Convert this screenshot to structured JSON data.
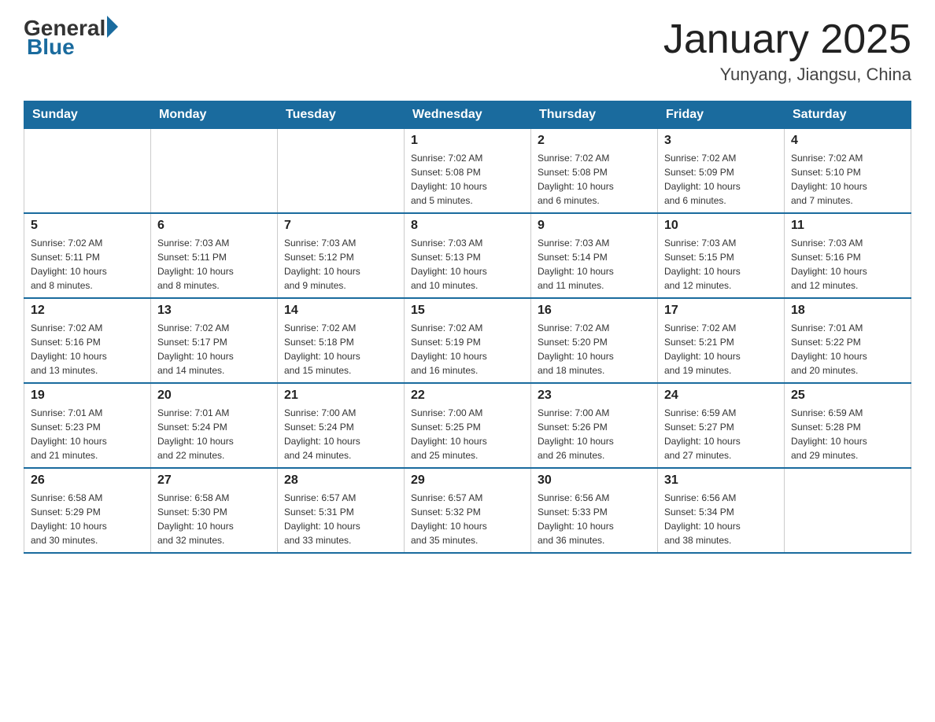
{
  "header": {
    "logo_general": "General",
    "logo_blue": "Blue",
    "month_title": "January 2025",
    "location": "Yunyang, Jiangsu, China"
  },
  "weekdays": [
    "Sunday",
    "Monday",
    "Tuesday",
    "Wednesday",
    "Thursday",
    "Friday",
    "Saturday"
  ],
  "weeks": [
    [
      {
        "day": "",
        "info": ""
      },
      {
        "day": "",
        "info": ""
      },
      {
        "day": "",
        "info": ""
      },
      {
        "day": "1",
        "info": "Sunrise: 7:02 AM\nSunset: 5:08 PM\nDaylight: 10 hours\nand 5 minutes."
      },
      {
        "day": "2",
        "info": "Sunrise: 7:02 AM\nSunset: 5:08 PM\nDaylight: 10 hours\nand 6 minutes."
      },
      {
        "day": "3",
        "info": "Sunrise: 7:02 AM\nSunset: 5:09 PM\nDaylight: 10 hours\nand 6 minutes."
      },
      {
        "day": "4",
        "info": "Sunrise: 7:02 AM\nSunset: 5:10 PM\nDaylight: 10 hours\nand 7 minutes."
      }
    ],
    [
      {
        "day": "5",
        "info": "Sunrise: 7:02 AM\nSunset: 5:11 PM\nDaylight: 10 hours\nand 8 minutes."
      },
      {
        "day": "6",
        "info": "Sunrise: 7:03 AM\nSunset: 5:11 PM\nDaylight: 10 hours\nand 8 minutes."
      },
      {
        "day": "7",
        "info": "Sunrise: 7:03 AM\nSunset: 5:12 PM\nDaylight: 10 hours\nand 9 minutes."
      },
      {
        "day": "8",
        "info": "Sunrise: 7:03 AM\nSunset: 5:13 PM\nDaylight: 10 hours\nand 10 minutes."
      },
      {
        "day": "9",
        "info": "Sunrise: 7:03 AM\nSunset: 5:14 PM\nDaylight: 10 hours\nand 11 minutes."
      },
      {
        "day": "10",
        "info": "Sunrise: 7:03 AM\nSunset: 5:15 PM\nDaylight: 10 hours\nand 12 minutes."
      },
      {
        "day": "11",
        "info": "Sunrise: 7:03 AM\nSunset: 5:16 PM\nDaylight: 10 hours\nand 12 minutes."
      }
    ],
    [
      {
        "day": "12",
        "info": "Sunrise: 7:02 AM\nSunset: 5:16 PM\nDaylight: 10 hours\nand 13 minutes."
      },
      {
        "day": "13",
        "info": "Sunrise: 7:02 AM\nSunset: 5:17 PM\nDaylight: 10 hours\nand 14 minutes."
      },
      {
        "day": "14",
        "info": "Sunrise: 7:02 AM\nSunset: 5:18 PM\nDaylight: 10 hours\nand 15 minutes."
      },
      {
        "day": "15",
        "info": "Sunrise: 7:02 AM\nSunset: 5:19 PM\nDaylight: 10 hours\nand 16 minutes."
      },
      {
        "day": "16",
        "info": "Sunrise: 7:02 AM\nSunset: 5:20 PM\nDaylight: 10 hours\nand 18 minutes."
      },
      {
        "day": "17",
        "info": "Sunrise: 7:02 AM\nSunset: 5:21 PM\nDaylight: 10 hours\nand 19 minutes."
      },
      {
        "day": "18",
        "info": "Sunrise: 7:01 AM\nSunset: 5:22 PM\nDaylight: 10 hours\nand 20 minutes."
      }
    ],
    [
      {
        "day": "19",
        "info": "Sunrise: 7:01 AM\nSunset: 5:23 PM\nDaylight: 10 hours\nand 21 minutes."
      },
      {
        "day": "20",
        "info": "Sunrise: 7:01 AM\nSunset: 5:24 PM\nDaylight: 10 hours\nand 22 minutes."
      },
      {
        "day": "21",
        "info": "Sunrise: 7:00 AM\nSunset: 5:24 PM\nDaylight: 10 hours\nand 24 minutes."
      },
      {
        "day": "22",
        "info": "Sunrise: 7:00 AM\nSunset: 5:25 PM\nDaylight: 10 hours\nand 25 minutes."
      },
      {
        "day": "23",
        "info": "Sunrise: 7:00 AM\nSunset: 5:26 PM\nDaylight: 10 hours\nand 26 minutes."
      },
      {
        "day": "24",
        "info": "Sunrise: 6:59 AM\nSunset: 5:27 PM\nDaylight: 10 hours\nand 27 minutes."
      },
      {
        "day": "25",
        "info": "Sunrise: 6:59 AM\nSunset: 5:28 PM\nDaylight: 10 hours\nand 29 minutes."
      }
    ],
    [
      {
        "day": "26",
        "info": "Sunrise: 6:58 AM\nSunset: 5:29 PM\nDaylight: 10 hours\nand 30 minutes."
      },
      {
        "day": "27",
        "info": "Sunrise: 6:58 AM\nSunset: 5:30 PM\nDaylight: 10 hours\nand 32 minutes."
      },
      {
        "day": "28",
        "info": "Sunrise: 6:57 AM\nSunset: 5:31 PM\nDaylight: 10 hours\nand 33 minutes."
      },
      {
        "day": "29",
        "info": "Sunrise: 6:57 AM\nSunset: 5:32 PM\nDaylight: 10 hours\nand 35 minutes."
      },
      {
        "day": "30",
        "info": "Sunrise: 6:56 AM\nSunset: 5:33 PM\nDaylight: 10 hours\nand 36 minutes."
      },
      {
        "day": "31",
        "info": "Sunrise: 6:56 AM\nSunset: 5:34 PM\nDaylight: 10 hours\nand 38 minutes."
      },
      {
        "day": "",
        "info": ""
      }
    ]
  ]
}
